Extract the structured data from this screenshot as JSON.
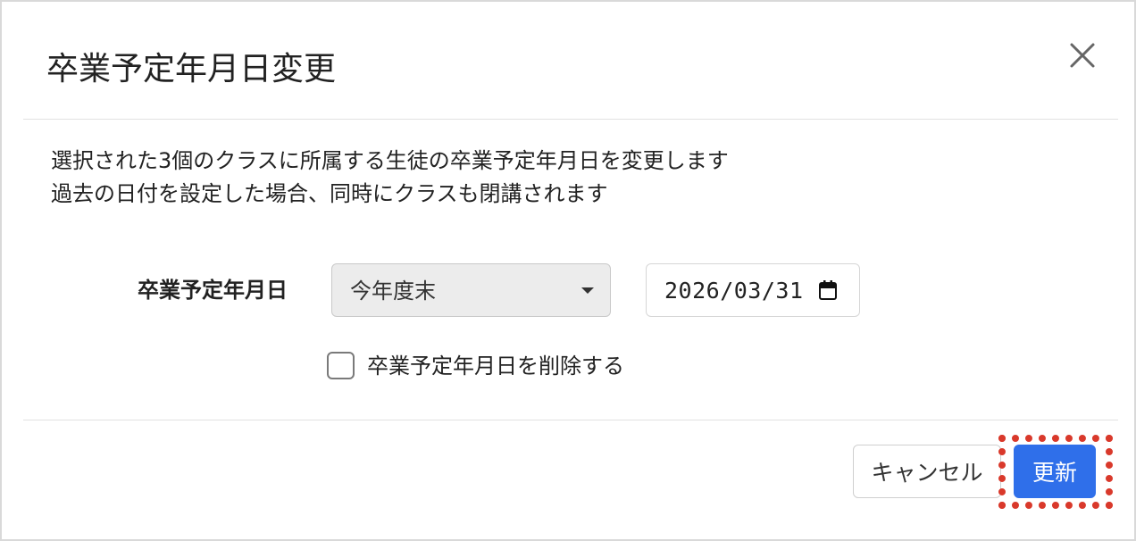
{
  "modal": {
    "title": "卒業予定年月日変更",
    "close_icon": "close-icon",
    "description": [
      "選択された3個のクラスに所属する生徒の卒業予定年月日を変更します",
      "過去の日付を設定した場合、同時にクラスも閉講されます"
    ],
    "field": {
      "label": "卒業予定年月日",
      "select_value": "今年度末",
      "date_value": "2026/03/31",
      "calendar_icon": "calendar-icon"
    },
    "checkbox": {
      "label": "卒業予定年月日を削除する",
      "checked": false
    },
    "buttons": {
      "cancel_label": "キャンセル",
      "update_label": "更新"
    }
  },
  "colors": {
    "primary": "#2f6fea",
    "highlight": "#d9392b",
    "select_bg": "#ececec"
  }
}
